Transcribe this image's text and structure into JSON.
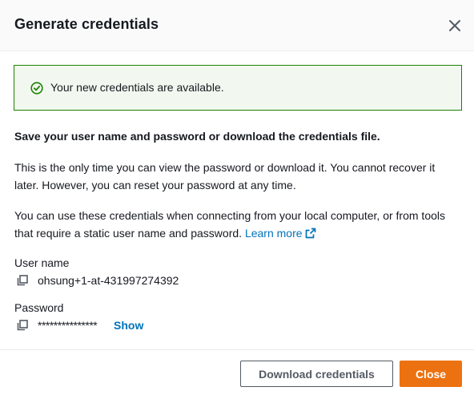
{
  "modal": {
    "title": "Generate credentials",
    "close_icon": "close-icon"
  },
  "alert": {
    "icon": "success-check-icon",
    "text": "Your new credentials are available."
  },
  "content": {
    "heading": "Save your user name and password or download the credentials file.",
    "paragraph1": "This is the only time you can view the password or download it. You cannot recover it later. However, you can reset your password at any time.",
    "paragraph2": "You can use these credentials when connecting from your local computer, or from tools that require a static user name and password.",
    "learn_more": "Learn more"
  },
  "username": {
    "label": "User name",
    "value": "ohsung+1-at-431997274392"
  },
  "password": {
    "label": "Password",
    "masked_value": "***************",
    "show_label": "Show"
  },
  "footer": {
    "download_label": "Download credentials",
    "close_label": "Close"
  },
  "colors": {
    "primary": "#ec7211",
    "link": "#0073bb",
    "success_border": "#1d8102",
    "success_bg": "#f2f8f0"
  }
}
